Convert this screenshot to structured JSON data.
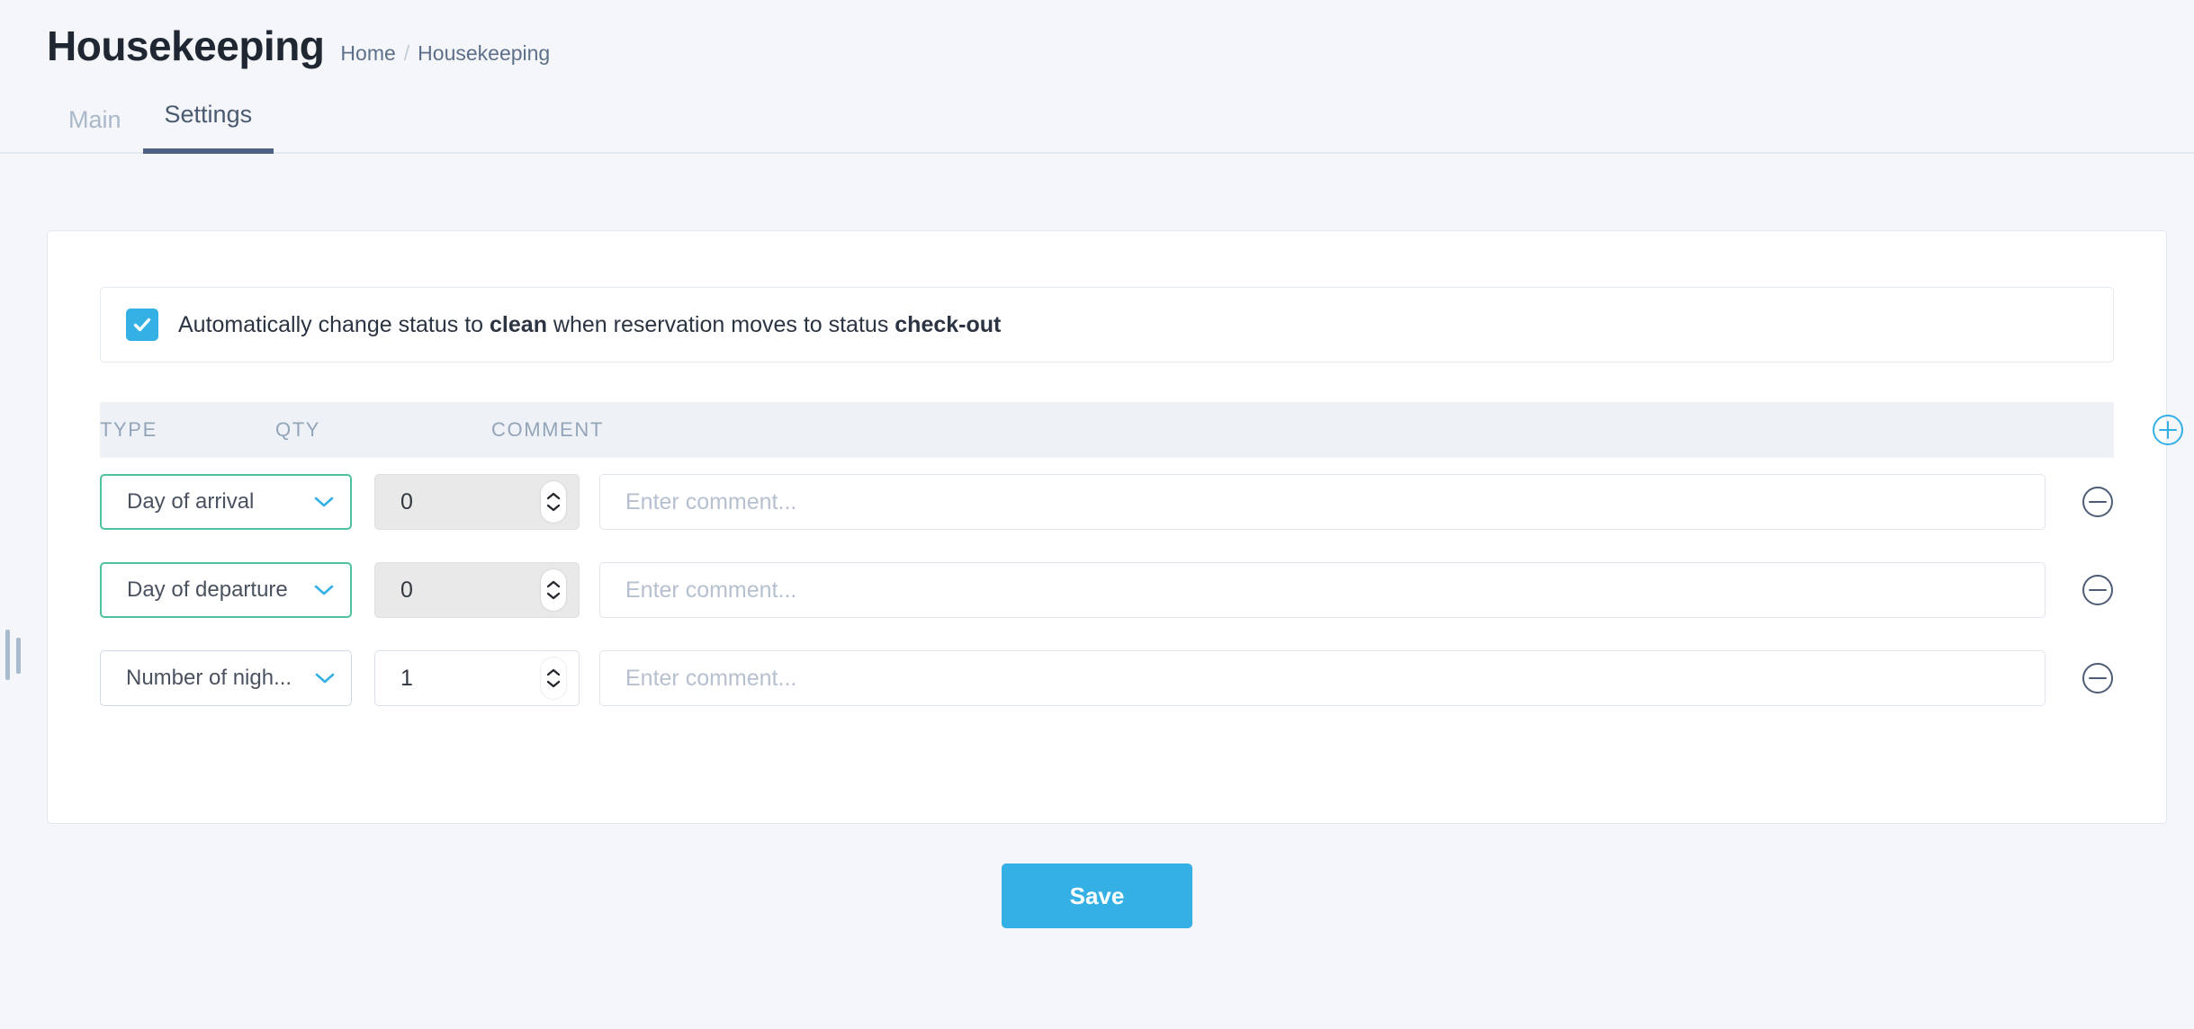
{
  "page": {
    "title": "Housekeeping",
    "background_color": "#f4f6fa"
  },
  "breadcrumb": {
    "home": "Home",
    "separator": "/",
    "current": "Housekeeping"
  },
  "tabs": [
    {
      "label": "Main",
      "active": false
    },
    {
      "label": "Settings",
      "active": true
    }
  ],
  "auto_status": {
    "checked": true,
    "text_part1": "Automatically change status to ",
    "status_from": "clean",
    "text_part2": " when reservation moves to status ",
    "status_to": "check-out"
  },
  "table": {
    "headers": {
      "type": "TYPE",
      "qty": "QTY",
      "comment": "COMMENT"
    },
    "add_icon": "plus-circle-icon",
    "rows": [
      {
        "type": "Day of arrival",
        "type_border": "green",
        "qty": "0",
        "qty_disabled": true,
        "comment_value": "",
        "comment_placeholder": "Enter comment...",
        "remove_icon": "minus-circle-icon"
      },
      {
        "type": "Day of departure",
        "type_border": "green",
        "qty": "0",
        "qty_disabled": true,
        "comment_value": "",
        "comment_placeholder": "Enter comment...",
        "remove_icon": "minus-circle-icon"
      },
      {
        "type": "Number of nigh...",
        "type_border": "default",
        "qty": "1",
        "qty_disabled": false,
        "comment_value": "",
        "comment_placeholder": "Enter comment...",
        "remove_icon": "minus-circle-icon"
      }
    ]
  },
  "actions": {
    "save_label": "Save"
  },
  "colors": {
    "accent_blue": "#35b0e5",
    "valid_green": "#4fc0a0",
    "tab_active": "#4e6180",
    "header_text": "#94a5ba"
  }
}
